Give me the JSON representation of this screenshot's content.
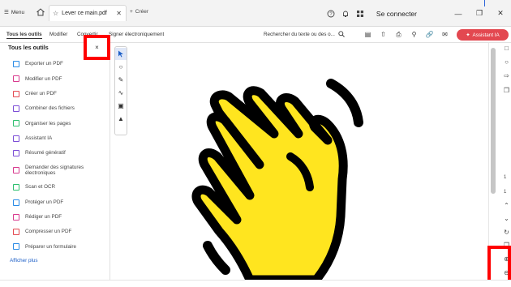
{
  "titlebar": {
    "menu_label": "Menu",
    "tab_title": "Lever ce main.pdf",
    "new_tab_label": "Créer",
    "connect_label": "Se connecter"
  },
  "toolbar": {
    "items": [
      {
        "label": "Tous les outils"
      },
      {
        "label": "Modifier"
      },
      {
        "label": "Convertir"
      },
      {
        "label": "Signer électroniquement"
      }
    ],
    "search_placeholder": "Rechercher du texte ou des o...",
    "ai_button_label": "Assistant IA"
  },
  "left_panel": {
    "title": "Tous les outils",
    "items": [
      {
        "label": "Exporter un PDF",
        "color": "#2a8be6"
      },
      {
        "label": "Modifier un PDF",
        "color": "#d83a8e"
      },
      {
        "label": "Créer un PDF",
        "color": "#e34850"
      },
      {
        "label": "Combiner des fichiers",
        "color": "#7c4dd6"
      },
      {
        "label": "Organiser les pages",
        "color": "#2dbf6e"
      },
      {
        "label": "Assistant IA",
        "color": "#7c4dd6"
      },
      {
        "label": "Résumé génératif",
        "color": "#7c4dd6"
      },
      {
        "label": "Demander des signatures électroniques",
        "color": "#d83a8e"
      },
      {
        "label": "Scan et OCR",
        "color": "#2dbf6e"
      },
      {
        "label": "Protéger un PDF",
        "color": "#2a8be6"
      },
      {
        "label": "Rédiger un PDF",
        "color": "#d83a8e"
      },
      {
        "label": "Compresser un PDF",
        "color": "#e34850"
      },
      {
        "label": "Préparer un formulaire",
        "color": "#2a8be6"
      }
    ],
    "show_more_label": "Afficher plus"
  },
  "right_rail": {
    "page_number": "1",
    "page_total": "1"
  },
  "colors": {
    "accent_red": "#e34850",
    "hand_yellow": "#ffe51f",
    "highlight_red": "#ff0000"
  }
}
